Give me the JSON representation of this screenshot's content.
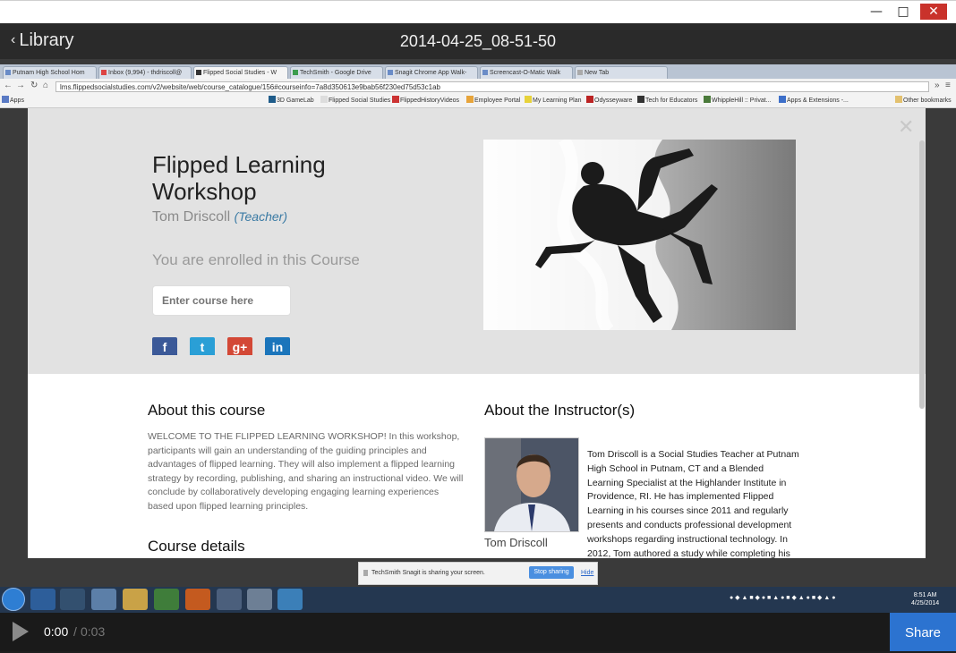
{
  "window": {
    "controls": {
      "minimize": "—",
      "maximize": "□",
      "close": "✕"
    }
  },
  "viewer": {
    "back_label": "Library",
    "title": "2014-04-25_08-51-50"
  },
  "browser": {
    "tabs": [
      {
        "label": "Putnam High School Hom"
      },
      {
        "label": "Inbox (9,994) - thdriscoll@"
      },
      {
        "label": "Flipped Social Studies - W"
      },
      {
        "label": "TechSmith - Google Drive"
      },
      {
        "label": "Snagit Chrome App Walk-"
      },
      {
        "label": "Screencast-O-Matic Walk"
      },
      {
        "label": "New Tab"
      }
    ],
    "url": "lms.flippedsocialstudies.com/v2/website/web/course_catalogue/156#courseinfo=7a8d350613e9bab56f230ed75d53c1ab",
    "bookmarks": [
      {
        "label": "Apps"
      },
      {
        "label": "3D GameLab"
      },
      {
        "label": "Flipped Social Studies"
      },
      {
        "label": "FlippedHistoryVideos"
      },
      {
        "label": "Employee Portal"
      },
      {
        "label": "My Learning Plan"
      },
      {
        "label": "Odysseyware"
      },
      {
        "label": "Tech for Educators"
      },
      {
        "label": "WhippleHill :: Privat..."
      },
      {
        "label": "Apps & Extensions -..."
      },
      {
        "label": "Other bookmarks"
      }
    ]
  },
  "course": {
    "title": "Flipped Learning Workshop",
    "instructor": "Tom Driscoll",
    "role": "(Teacher)",
    "enrolled_text": "You are enrolled in this Course",
    "code_placeholder": "Enter course here",
    "close_glyph": "✕",
    "share": [
      {
        "label": "f",
        "color": "#3b5998"
      },
      {
        "label": "t",
        "color": "#2a9fd6"
      },
      {
        "label": "g+",
        "color": "#d34836"
      },
      {
        "label": "in",
        "color": "#1b75bb"
      }
    ],
    "about_heading": "About this course",
    "about_body": "WELCOME TO THE FLIPPED LEARNING WORKSHOP! In this workshop, participants will gain an understanding of the guiding principles and advantages of flipped learning. They will also implement a flipped learning strategy by recording, publishing, and sharing an instructional video. We will conclude by collaboratively developing engaging learning experiences based upon flipped learning principles.",
    "details_heading": "Course details",
    "instructor_heading": "About the Instructor(s)",
    "instructor_name": "Tom Driscoll",
    "bio": "Tom Driscoll is a Social Studies Teacher at Putnam High School in Putnam, CT and a Blended Learning Specialist at the Highlander Institute in Providence, RI.  He has implemented Flipped Learning in his courses since 2011 and regularly presents and conducts professional development workshops regarding instructional technology.  In 2012, Tom authored a study while completing his"
  },
  "snagit": {
    "message": "TechSmith Snagit is sharing your screen.",
    "stop_label": "Stop sharing",
    "hide_label": "Hide"
  },
  "taskbar": {
    "clock_time": "8:51 AM",
    "clock_date": "4/25/2014"
  },
  "player": {
    "current": "0:00",
    "separator": "/",
    "duration": "0:03",
    "share_label": "Share"
  },
  "colors": {
    "accent": "#2c73d0",
    "close_red": "#c9322b"
  }
}
